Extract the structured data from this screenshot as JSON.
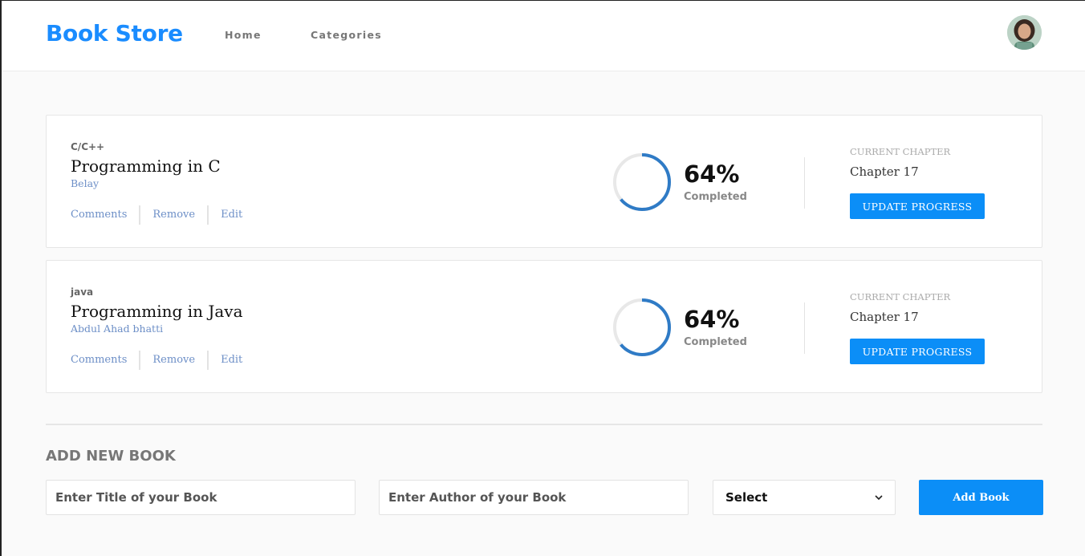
{
  "header": {
    "brand": "Book Store",
    "nav": [
      {
        "label": "Home"
      },
      {
        "label": "Categories"
      }
    ]
  },
  "books": [
    {
      "category": "C/C++",
      "title": "Programming in C",
      "author": "Belay",
      "actions": [
        "Comments",
        "Remove",
        "Edit"
      ],
      "progress": 64,
      "progress_text": "64%",
      "completed_label": "Completed",
      "chapter_label": "CURRENT CHAPTER",
      "chapter": "Chapter 17",
      "update_label": "UPDATE PROGRESS"
    },
    {
      "category": "java",
      "title": "Programming in Java",
      "author": "Abdul Ahad bhatti",
      "actions": [
        "Comments",
        "Remove",
        "Edit"
      ],
      "progress": 64,
      "progress_text": "64%",
      "completed_label": "Completed",
      "chapter_label": "CURRENT CHAPTER",
      "chapter": "Chapter 17",
      "update_label": "UPDATE PROGRESS"
    }
  ],
  "add_book": {
    "heading": "ADD NEW BOOK",
    "title_placeholder": "Enter Title of your Book",
    "author_placeholder": "Enter Author of your Book",
    "select_value": "Select",
    "button_label": "Add Book"
  },
  "colors": {
    "brand": "#1a8cff",
    "button": "#0b8ef7",
    "progress": "#2f7bc6",
    "track": "#e8e8e8",
    "link": "#6d8fc7"
  },
  "icons": {
    "select_arrow": "chevron-down-icon"
  }
}
